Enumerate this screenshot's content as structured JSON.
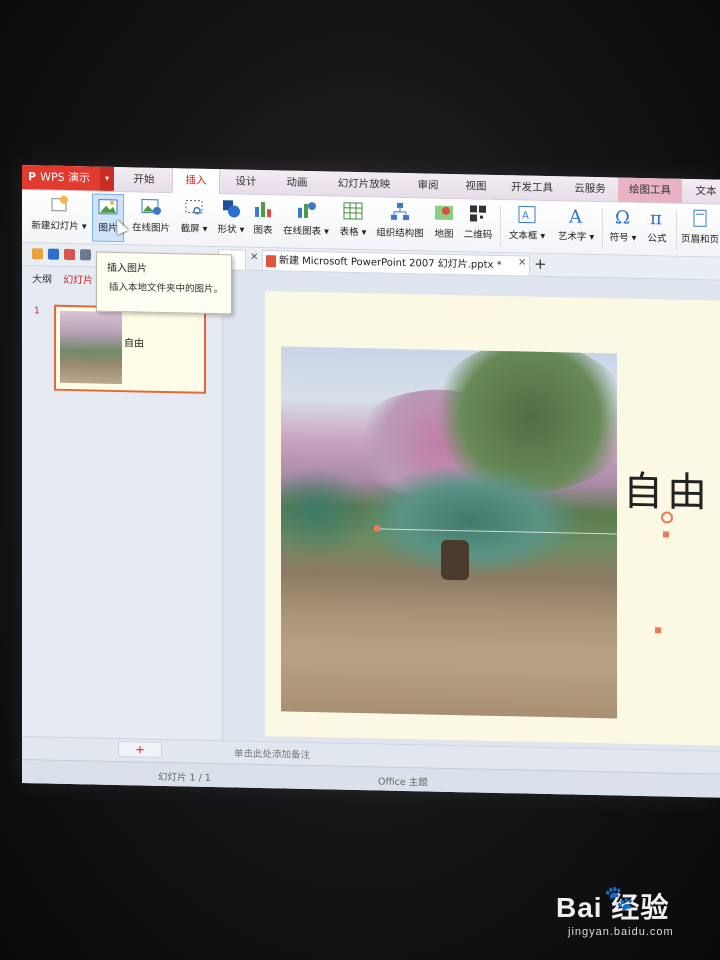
{
  "app": {
    "name": "WPS 演示",
    "brand_color": "#e23a2e"
  },
  "ribbon_tabs": [
    {
      "label": "开始"
    },
    {
      "label": "插入",
      "active": true
    },
    {
      "label": "设计"
    },
    {
      "label": "动画"
    },
    {
      "label": "幻灯片放映"
    },
    {
      "label": "审阅"
    },
    {
      "label": "视图"
    },
    {
      "label": "开发工具"
    },
    {
      "label": "云服务"
    },
    {
      "label": "绘图工具"
    },
    {
      "label": "文本"
    }
  ],
  "ribbon_buttons": [
    {
      "label": "新建幻灯片 ▾",
      "icon": "new-slide-icon"
    },
    {
      "label": "图片",
      "icon": "picture-icon",
      "hovered": true
    },
    {
      "label": "在线图片",
      "icon": "online-picture-icon"
    },
    {
      "label": "截屏 ▾",
      "icon": "screenshot-icon"
    },
    {
      "label": "形状 ▾",
      "icon": "shapes-icon"
    },
    {
      "label": "图表",
      "icon": "chart-icon"
    },
    {
      "label": "在线图表 ▾",
      "icon": "online-chart-icon"
    },
    {
      "label": "表格 ▾",
      "icon": "table-icon"
    },
    {
      "label": "组织结构图",
      "icon": "org-chart-icon"
    },
    {
      "label": "地图",
      "icon": "map-icon"
    },
    {
      "label": "二维码",
      "icon": "qr-code-icon"
    },
    {
      "label": "文本框 ▾",
      "icon": "textbox-icon"
    },
    {
      "label": "艺术字 ▾",
      "icon": "wordart-icon"
    },
    {
      "label": "符号 ▾",
      "icon": "symbol-icon"
    },
    {
      "label": "公式",
      "icon": "formula-icon"
    },
    {
      "label": "页眉和页",
      "icon": "header-footer-icon"
    }
  ],
  "tooltip": {
    "title": "插入图片",
    "description": "插入本地文件夹中的图片。"
  },
  "doc_tabs": [
    {
      "label": "S",
      "partial": true
    },
    {
      "label": "新建 Microsoft PowerPoint 2007 幻灯片.pptx *",
      "active": true
    }
  ],
  "left_panel": {
    "outline_tab": "大纲",
    "slides_tab": "幻灯片",
    "thumb_number": "1",
    "thumb_title": "自由"
  },
  "slide": {
    "title": "自由"
  },
  "notes": {
    "add_slide": "+",
    "hint": "单击此处添加备注"
  },
  "statusbar": {
    "slide_counter": "幻灯片 1 / 1",
    "theme": "Office 主题"
  },
  "watermark": {
    "brand": "Bai  经验",
    "url": "jingyan.baidu.com"
  }
}
